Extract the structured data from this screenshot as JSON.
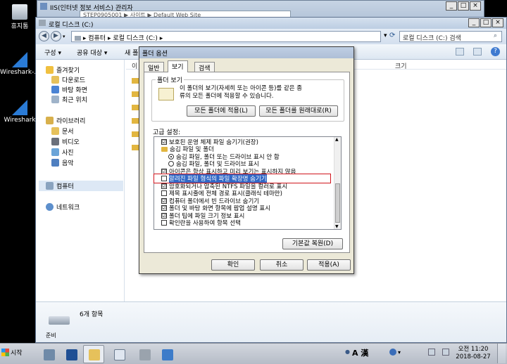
{
  "desktop": {
    "icons": [
      {
        "label": "휴지통"
      },
      {
        "label": "Wireshark-..."
      },
      {
        "label": "Wireshark"
      }
    ]
  },
  "iis": {
    "title": "IIS(인터넷 정보 서비스) 관리자",
    "address": "STEP0905001 ▶ 사이트 ▶ Default Web Site"
  },
  "explorer": {
    "title": "로컬 디스크 (C:)",
    "address": [
      "컴퓨터",
      "로컬 디스크 (C:)"
    ],
    "search_placeholder": "로컬 디스크 (C:) 검색",
    "toolbar": {
      "organize": "구성",
      "share": "공유 대상",
      "new_folder": "새 폴"
    },
    "nav": {
      "favorites": "즐겨찾기",
      "downloads": "다운로드",
      "desktop": "바탕 화면",
      "recent": "최근 위치",
      "libraries": "라이브러리",
      "documents": "문서",
      "video": "비디오",
      "pictures": "사진",
      "music": "음악",
      "computer": "컴퓨터",
      "network": "네트워크"
    },
    "columns": {
      "name": "이",
      "size": "크기"
    },
    "status": {
      "count": "6개 항목",
      "short": "준비"
    }
  },
  "dialog": {
    "title": "폴더 옵션",
    "tabs": {
      "general": "일반",
      "view": "보기",
      "search": "검색"
    },
    "folder_view": {
      "group": "폴더 보기",
      "desc_1": "이 폴더의 보기(자세히 또는 아이콘 등)를 같은 종",
      "desc_2": "류의 모든 폴더에 적용할 수 있습니다.",
      "apply_btn": "모든 폴더에 적용(L)",
      "reset_btn": "모든 폴더를 원래대로(R)"
    },
    "advanced_label": "고급 설정:",
    "items": [
      {
        "text": "보호된 운영 체제 파일 숨기기(권장)",
        "kind": "check",
        "checked": "☑"
      },
      {
        "text": "숨김 파일 및 폴더",
        "kind": "folder"
      },
      {
        "text": "숨김 파일, 폴더 또는 드라이브 표시 안 함",
        "kind": "radio",
        "on": true
      },
      {
        "text": "숨김 파일, 폴더 및 드라이브 표시",
        "kind": "radio",
        "on": false
      },
      {
        "text": "아이콘은 항상 표시하고 미리 보기는 표시하지 않음",
        "kind": "check",
        "checked": "☑"
      },
      {
        "text": "알려진 파일 형식의 파일 확장명 숨기기",
        "kind": "check",
        "checked": "",
        "highlight": true
      },
      {
        "text": "암호화되거나 압축된 NTFS 파일을 컬러로 표시",
        "kind": "check",
        "checked": "☑"
      },
      {
        "text": "제목 표시줄에 전체 경로 표시(클래식 테마만)",
        "kind": "check",
        "checked": ""
      },
      {
        "text": "컴퓨터 폴더에서 빈 드라이브 숨기기",
        "kind": "check",
        "checked": "☑"
      },
      {
        "text": "폴더 및 바탕 화면 항목에 팝업 설명 표시",
        "kind": "check",
        "checked": "☑"
      },
      {
        "text": "폴더 팁에 파일 크기 정보 표시",
        "kind": "check",
        "checked": "☑"
      },
      {
        "text": "확인란을 사용하여 항목 선택",
        "kind": "check",
        "checked": ""
      }
    ],
    "restore_btn": "기본값 복원(D)",
    "ok": "확인",
    "cancel": "취소",
    "apply": "적용(A)"
  },
  "taskbar": {
    "start": "시작",
    "clock_time": "오전 11:20",
    "clock_date": "2018-08-27",
    "ime": "A 漢"
  },
  "colors": {
    "highlight": "#3168c6",
    "annotation": "#d0141c"
  }
}
